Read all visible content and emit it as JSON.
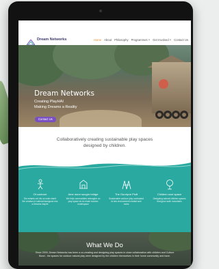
{
  "nav": {
    "logo_text": "Dream Networks",
    "items": [
      {
        "label": "Home",
        "active": true
      },
      {
        "label": "About"
      },
      {
        "label": "Philosophy"
      },
      {
        "label": "Programmes ˅"
      },
      {
        "label": "Get Involved ˅"
      },
      {
        "label": "Contact Us"
      }
    ]
  },
  "hero": {
    "title": "Dream Networks",
    "subtitle_line1": "Creating PlayHAI",
    "subtitle_line2": "Making Dreams a Reality",
    "button_label": "Contact Us",
    "scroll_icon": "chevron-down-icon"
  },
  "tagline": {
    "line1": "Collaboratively creating sustainable play spaces",
    "line2": "designed by children."
  },
  "features": [
    {
      "icon": "child-icon",
      "title": "Ot contront",
      "text": "Dis enfants ont dis un outin elarrit the creatan re sdenad taanguwe ens a Dreams inspire"
    },
    {
      "icon": "building-icon",
      "title": "Ame mure sougnr bridge",
      "text": "We help communities reimagine un play space at clo elude toucton onderspace"
    },
    {
      "icon": "play-structure-icon",
      "title": "The Gurclyne Pluft",
      "text": "Sustainable outdoor play contracted fa bes environment mantal weir rocks"
    },
    {
      "icon": "tree-icon",
      "title": "Children soot space",
      "text": "Designing natural children spaces that grow woth mountains"
    }
  ],
  "what_we_do": {
    "title": "What We Do",
    "text": "Since 2009, Dream Networks has been a co-creating and designing play spaces in close collaboration with children and Culture Bond - the spaces for outdoor natural play were designed by the children themselves in their home community and have."
  },
  "colors": {
    "accent_purple": "#7a4fc4",
    "nav_active": "#e58f2a",
    "teal": "#2aa9a0"
  }
}
